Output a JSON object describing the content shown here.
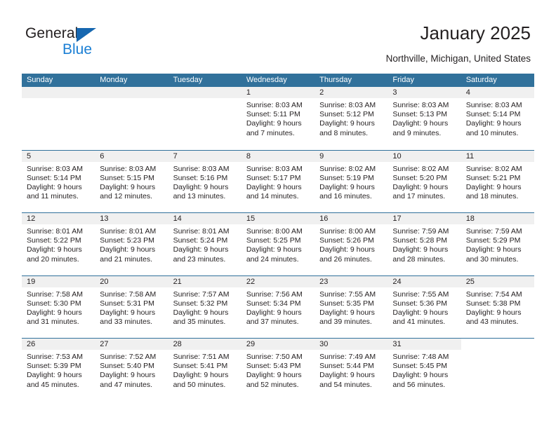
{
  "brand": {
    "word_one": "General",
    "word_two": "Blue",
    "triangle_color": "#1667b0",
    "blue_text_color": "#1b7fd4"
  },
  "header": {
    "title": "January 2025",
    "subtitle": "Northville, Michigan, United States",
    "header_bg_color": "#31719b",
    "daynum_bg_color": "#f0f0f0"
  },
  "weekdays": [
    "Sunday",
    "Monday",
    "Tuesday",
    "Wednesday",
    "Thursday",
    "Friday",
    "Saturday"
  ],
  "weeks": [
    [
      {
        "day": "",
        "blank": true
      },
      {
        "day": "",
        "blank": true
      },
      {
        "day": "",
        "blank": true
      },
      {
        "day": "1",
        "sunrise": "Sunrise: 8:03 AM",
        "sunset": "Sunset: 5:11 PM",
        "daylight1": "Daylight: 9 hours",
        "daylight2": "and 7 minutes."
      },
      {
        "day": "2",
        "sunrise": "Sunrise: 8:03 AM",
        "sunset": "Sunset: 5:12 PM",
        "daylight1": "Daylight: 9 hours",
        "daylight2": "and 8 minutes."
      },
      {
        "day": "3",
        "sunrise": "Sunrise: 8:03 AM",
        "sunset": "Sunset: 5:13 PM",
        "daylight1": "Daylight: 9 hours",
        "daylight2": "and 9 minutes."
      },
      {
        "day": "4",
        "sunrise": "Sunrise: 8:03 AM",
        "sunset": "Sunset: 5:14 PM",
        "daylight1": "Daylight: 9 hours",
        "daylight2": "and 10 minutes."
      }
    ],
    [
      {
        "day": "5",
        "sunrise": "Sunrise: 8:03 AM",
        "sunset": "Sunset: 5:14 PM",
        "daylight1": "Daylight: 9 hours",
        "daylight2": "and 11 minutes."
      },
      {
        "day": "6",
        "sunrise": "Sunrise: 8:03 AM",
        "sunset": "Sunset: 5:15 PM",
        "daylight1": "Daylight: 9 hours",
        "daylight2": "and 12 minutes."
      },
      {
        "day": "7",
        "sunrise": "Sunrise: 8:03 AM",
        "sunset": "Sunset: 5:16 PM",
        "daylight1": "Daylight: 9 hours",
        "daylight2": "and 13 minutes."
      },
      {
        "day": "8",
        "sunrise": "Sunrise: 8:03 AM",
        "sunset": "Sunset: 5:17 PM",
        "daylight1": "Daylight: 9 hours",
        "daylight2": "and 14 minutes."
      },
      {
        "day": "9",
        "sunrise": "Sunrise: 8:02 AM",
        "sunset": "Sunset: 5:19 PM",
        "daylight1": "Daylight: 9 hours",
        "daylight2": "and 16 minutes."
      },
      {
        "day": "10",
        "sunrise": "Sunrise: 8:02 AM",
        "sunset": "Sunset: 5:20 PM",
        "daylight1": "Daylight: 9 hours",
        "daylight2": "and 17 minutes."
      },
      {
        "day": "11",
        "sunrise": "Sunrise: 8:02 AM",
        "sunset": "Sunset: 5:21 PM",
        "daylight1": "Daylight: 9 hours",
        "daylight2": "and 18 minutes."
      }
    ],
    [
      {
        "day": "12",
        "sunrise": "Sunrise: 8:01 AM",
        "sunset": "Sunset: 5:22 PM",
        "daylight1": "Daylight: 9 hours",
        "daylight2": "and 20 minutes."
      },
      {
        "day": "13",
        "sunrise": "Sunrise: 8:01 AM",
        "sunset": "Sunset: 5:23 PM",
        "daylight1": "Daylight: 9 hours",
        "daylight2": "and 21 minutes."
      },
      {
        "day": "14",
        "sunrise": "Sunrise: 8:01 AM",
        "sunset": "Sunset: 5:24 PM",
        "daylight1": "Daylight: 9 hours",
        "daylight2": "and 23 minutes."
      },
      {
        "day": "15",
        "sunrise": "Sunrise: 8:00 AM",
        "sunset": "Sunset: 5:25 PM",
        "daylight1": "Daylight: 9 hours",
        "daylight2": "and 24 minutes."
      },
      {
        "day": "16",
        "sunrise": "Sunrise: 8:00 AM",
        "sunset": "Sunset: 5:26 PM",
        "daylight1": "Daylight: 9 hours",
        "daylight2": "and 26 minutes."
      },
      {
        "day": "17",
        "sunrise": "Sunrise: 7:59 AM",
        "sunset": "Sunset: 5:28 PM",
        "daylight1": "Daylight: 9 hours",
        "daylight2": "and 28 minutes."
      },
      {
        "day": "18",
        "sunrise": "Sunrise: 7:59 AM",
        "sunset": "Sunset: 5:29 PM",
        "daylight1": "Daylight: 9 hours",
        "daylight2": "and 30 minutes."
      }
    ],
    [
      {
        "day": "19",
        "sunrise": "Sunrise: 7:58 AM",
        "sunset": "Sunset: 5:30 PM",
        "daylight1": "Daylight: 9 hours",
        "daylight2": "and 31 minutes."
      },
      {
        "day": "20",
        "sunrise": "Sunrise: 7:58 AM",
        "sunset": "Sunset: 5:31 PM",
        "daylight1": "Daylight: 9 hours",
        "daylight2": "and 33 minutes."
      },
      {
        "day": "21",
        "sunrise": "Sunrise: 7:57 AM",
        "sunset": "Sunset: 5:32 PM",
        "daylight1": "Daylight: 9 hours",
        "daylight2": "and 35 minutes."
      },
      {
        "day": "22",
        "sunrise": "Sunrise: 7:56 AM",
        "sunset": "Sunset: 5:34 PM",
        "daylight1": "Daylight: 9 hours",
        "daylight2": "and 37 minutes."
      },
      {
        "day": "23",
        "sunrise": "Sunrise: 7:55 AM",
        "sunset": "Sunset: 5:35 PM",
        "daylight1": "Daylight: 9 hours",
        "daylight2": "and 39 minutes."
      },
      {
        "day": "24",
        "sunrise": "Sunrise: 7:55 AM",
        "sunset": "Sunset: 5:36 PM",
        "daylight1": "Daylight: 9 hours",
        "daylight2": "and 41 minutes."
      },
      {
        "day": "25",
        "sunrise": "Sunrise: 7:54 AM",
        "sunset": "Sunset: 5:38 PM",
        "daylight1": "Daylight: 9 hours",
        "daylight2": "and 43 minutes."
      }
    ],
    [
      {
        "day": "26",
        "sunrise": "Sunrise: 7:53 AM",
        "sunset": "Sunset: 5:39 PM",
        "daylight1": "Daylight: 9 hours",
        "daylight2": "and 45 minutes."
      },
      {
        "day": "27",
        "sunrise": "Sunrise: 7:52 AM",
        "sunset": "Sunset: 5:40 PM",
        "daylight1": "Daylight: 9 hours",
        "daylight2": "and 47 minutes."
      },
      {
        "day": "28",
        "sunrise": "Sunrise: 7:51 AM",
        "sunset": "Sunset: 5:41 PM",
        "daylight1": "Daylight: 9 hours",
        "daylight2": "and 50 minutes."
      },
      {
        "day": "29",
        "sunrise": "Sunrise: 7:50 AM",
        "sunset": "Sunset: 5:43 PM",
        "daylight1": "Daylight: 9 hours",
        "daylight2": "and 52 minutes."
      },
      {
        "day": "30",
        "sunrise": "Sunrise: 7:49 AM",
        "sunset": "Sunset: 5:44 PM",
        "daylight1": "Daylight: 9 hours",
        "daylight2": "and 54 minutes."
      },
      {
        "day": "31",
        "sunrise": "Sunrise: 7:48 AM",
        "sunset": "Sunset: 5:45 PM",
        "daylight1": "Daylight: 9 hours",
        "daylight2": "and 56 minutes."
      },
      {
        "day": "",
        "empty": true
      }
    ]
  ]
}
